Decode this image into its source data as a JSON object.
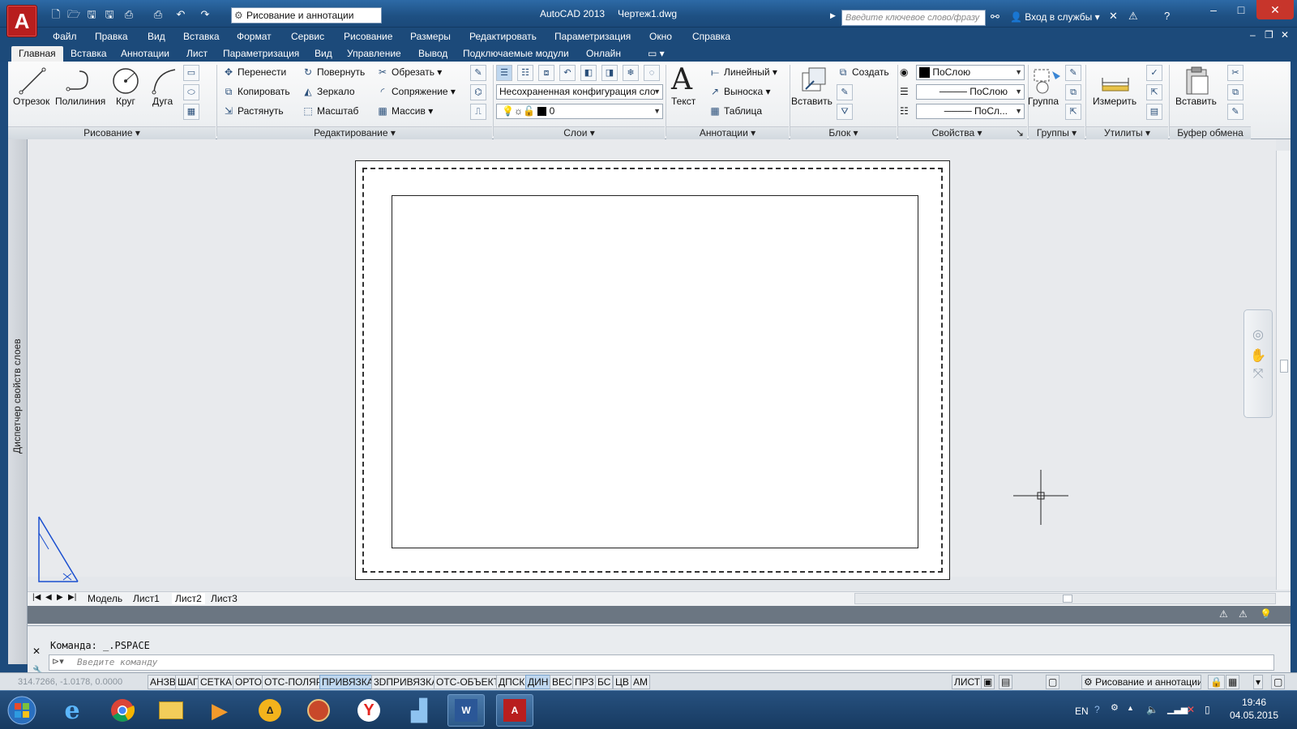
{
  "titlebar": {
    "app_title": "AutoCAD 2013",
    "doc_title": "Чертеж1.dwg",
    "workspace": "Рисование и аннотации",
    "search_placeholder": "Введите ключевое слово/фразу",
    "signin": "Вход в службы"
  },
  "menu": [
    "Файл",
    "Правка",
    "Вид",
    "Вставка",
    "Формат",
    "Сервис",
    "Рисование",
    "Размеры",
    "Редактировать",
    "Параметризация",
    "Окно",
    "Справка"
  ],
  "ribbon_tabs": [
    "Главная",
    "Вставка",
    "Аннотации",
    "Лист",
    "Параметризация",
    "Вид",
    "Управление",
    "Вывод",
    "Подключаемые модули",
    "Онлайн"
  ],
  "ribbon": {
    "draw": {
      "title": "Рисование",
      "line": "Отрезок",
      "polyline": "Полилиния",
      "circle": "Круг",
      "arc": "Дуга"
    },
    "modify": {
      "title": "Редактирование",
      "move": "Перенести",
      "rotate": "Повернуть",
      "trim": "Обрезать",
      "copy": "Копировать",
      "mirror": "Зеркало",
      "fillet": "Сопряжение",
      "stretch": "Растянуть",
      "scale": "Масштаб",
      "array": "Массив"
    },
    "layers": {
      "title": "Слои",
      "state": "Несохраненная конфигурация сло",
      "current": "0"
    },
    "annotation": {
      "title": "Аннотации",
      "text": "Текст",
      "linear": "Линейный",
      "leader": "Выноска",
      "table": "Таблица"
    },
    "block": {
      "title": "Блок",
      "insert": "Вставить",
      "create": "Создать"
    },
    "properties": {
      "title": "Свойства",
      "color": "ПоСлою",
      "linetype": "ПоСлою",
      "lineweight": "ПоСл..."
    },
    "groups": {
      "title": "Группы",
      "group": "Группа"
    },
    "utilities": {
      "title": "Утилиты",
      "measure": "Измерить"
    },
    "clipboard": {
      "title": "Буфер обмена",
      "paste": "Вставить"
    }
  },
  "palette_title": "Диспетчер свойств слоев",
  "layout_tabs": [
    "Модель",
    "Лист1",
    "Лист2",
    "Лист3"
  ],
  "command": {
    "history": "Команда:  _.PSPACE",
    "placeholder": "Введите команду"
  },
  "status": {
    "coords": "314.7266, -1.0178, 0.0000",
    "toggles": [
      {
        "label": "АНЗВ",
        "on": false
      },
      {
        "label": "ШАГ",
        "on": false
      },
      {
        "label": "СЕТКА",
        "on": false
      },
      {
        "label": "ОРТО",
        "on": false
      },
      {
        "label": "ОТС-ПОЛЯР",
        "on": false
      },
      {
        "label": "ПРИВЯЗКА",
        "on": true
      },
      {
        "label": "3DПРИВЯЗКА",
        "on": false
      },
      {
        "label": "ОТС-ОБЪЕКТ",
        "on": false
      },
      {
        "label": "ДПСК",
        "on": false
      },
      {
        "label": "ДИН",
        "on": true
      },
      {
        "label": "ВЕС",
        "on": false
      },
      {
        "label": "ПРЗ",
        "on": false
      },
      {
        "label": "БС",
        "on": false
      },
      {
        "label": "ЦВ",
        "on": false
      },
      {
        "label": "АМ",
        "on": false
      }
    ],
    "sheet": "ЛИСТ",
    "workspace": "Рисование и аннотации"
  },
  "taskbar": {
    "lang": "EN",
    "time": "19:46",
    "date": "04.05.2015"
  },
  "colors": {
    "accent": "#1c4a7a",
    "autocad_red": "#b81e1e",
    "close_red": "#c7352b",
    "toggle_on": "#bfd7ef"
  }
}
